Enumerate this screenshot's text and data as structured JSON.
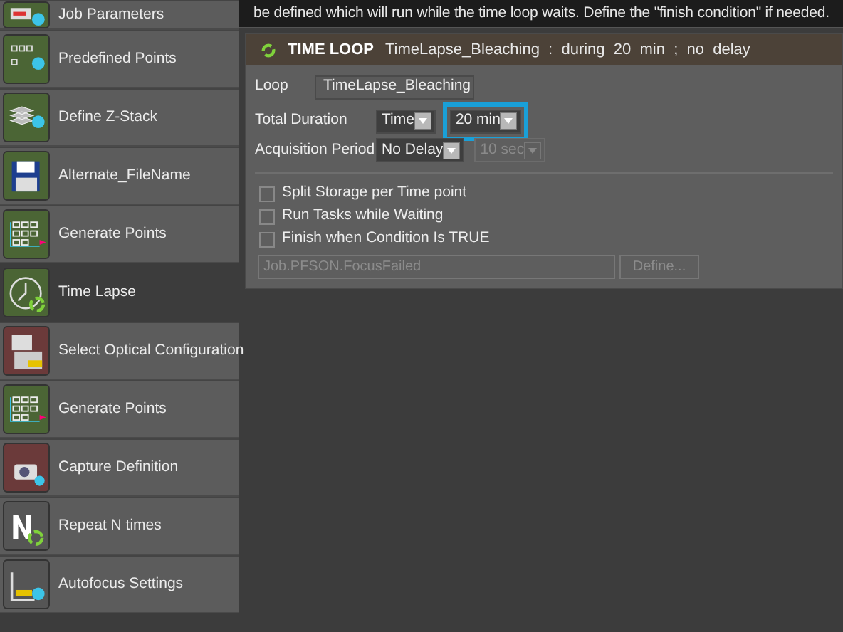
{
  "sidebar": {
    "items": [
      {
        "label": "Job Parameters",
        "kind": "params",
        "color": "#4b6535",
        "selected": false
      },
      {
        "label": "Predefined Points",
        "kind": "points",
        "color": "#4b6535",
        "selected": false
      },
      {
        "label": "Define Z-Stack",
        "kind": "zstack",
        "color": "#4b6535",
        "selected": false
      },
      {
        "label": "Alternate_FileName",
        "kind": "file",
        "color": "#4b6535",
        "selected": false
      },
      {
        "label": "Generate Points",
        "kind": "generate",
        "color": "#4b6535",
        "selected": false
      },
      {
        "label": "Time Lapse",
        "kind": "timelapse",
        "color": "#4b6535",
        "selected": true
      },
      {
        "label": "Select Optical Configuration",
        "kind": "optical",
        "color": "#6b3a3a",
        "selected": false
      },
      {
        "label": "Generate Points",
        "kind": "generate",
        "color": "#4b6535",
        "selected": false
      },
      {
        "label": "Capture Definition",
        "kind": "capture",
        "color": "#6b3a3a",
        "selected": false
      },
      {
        "label": "Repeat N times",
        "kind": "repeat",
        "color": "#555555",
        "selected": false
      },
      {
        "label": "Autofocus Settings",
        "kind": "autofocus",
        "color": "#555555",
        "selected": false
      }
    ]
  },
  "description": "be defined which will run while the time loop waits. Define the \"finish condition\" if needed.",
  "panel": {
    "title": "TIME LOOP",
    "summary": "TimeLapse_Bleaching  :  during  20  min  ;  no  delay",
    "loop": {
      "label": "Loop",
      "value": "TimeLapse_Bleaching"
    },
    "total_duration": {
      "label": "Total Duration",
      "mode": "Time",
      "value": "20 min",
      "highlighted": true
    },
    "acquisition_period": {
      "label": "Acquisition Period",
      "mode": "No Delay",
      "value": "10 sec",
      "disabled": true
    },
    "options": [
      {
        "label": "Split Storage per Time point",
        "checked": false
      },
      {
        "label": "Run Tasks while Waiting",
        "checked": false
      },
      {
        "label": "Finish when Condition Is TRUE",
        "checked": false
      }
    ],
    "condition": {
      "value": "Job.PFSON.FocusFailed",
      "disabled": true
    },
    "define_button": {
      "label": "Define...",
      "disabled": true
    }
  }
}
